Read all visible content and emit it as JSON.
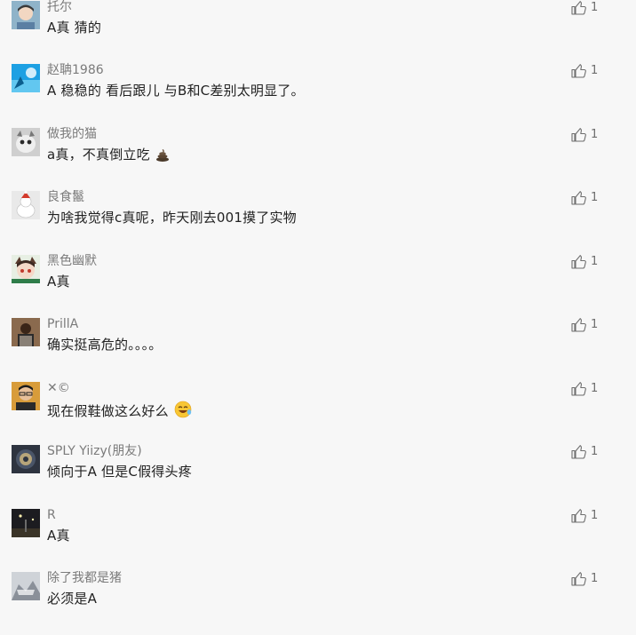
{
  "comments": [
    {
      "name": "托尔",
      "text": "A真  猜的",
      "likes": "1",
      "emoji": ""
    },
    {
      "name": "赵聃1986",
      "text": "A 稳稳的  看后跟儿 与B和C差别太明显了。",
      "likes": "1",
      "emoji": ""
    },
    {
      "name": "做我的猫",
      "text": "a真，不真倒立吃",
      "likes": "1",
      "emoji": "poop-emoji"
    },
    {
      "name": "良食鬣",
      "text": "为啥我觉得c真呢，昨天刚去001摸了实物",
      "likes": "1",
      "emoji": ""
    },
    {
      "name": "黑色幽默",
      "text": "A真",
      "likes": "1",
      "emoji": ""
    },
    {
      "name": "PrillA",
      "text": "确实挺高危的。。。。",
      "likes": "1",
      "emoji": ""
    },
    {
      "name": "✕©",
      "text": "现在假鞋做这么好么",
      "likes": "1",
      "emoji": "laughing-emoji"
    },
    {
      "name": "SPLY Yiizy(朋友)",
      "text": "倾向于A 但是C假得头疼",
      "likes": "1",
      "emoji": ""
    },
    {
      "name": "R",
      "text": "A真",
      "likes": "1",
      "emoji": ""
    },
    {
      "name": "除了我都是猪",
      "text": "必须是A",
      "likes": "1",
      "emoji": ""
    }
  ],
  "colors": {
    "background": "#f7f7f7",
    "name": "#7b7b7b",
    "text": "#222222",
    "like_icon": "#6e6e6e"
  }
}
